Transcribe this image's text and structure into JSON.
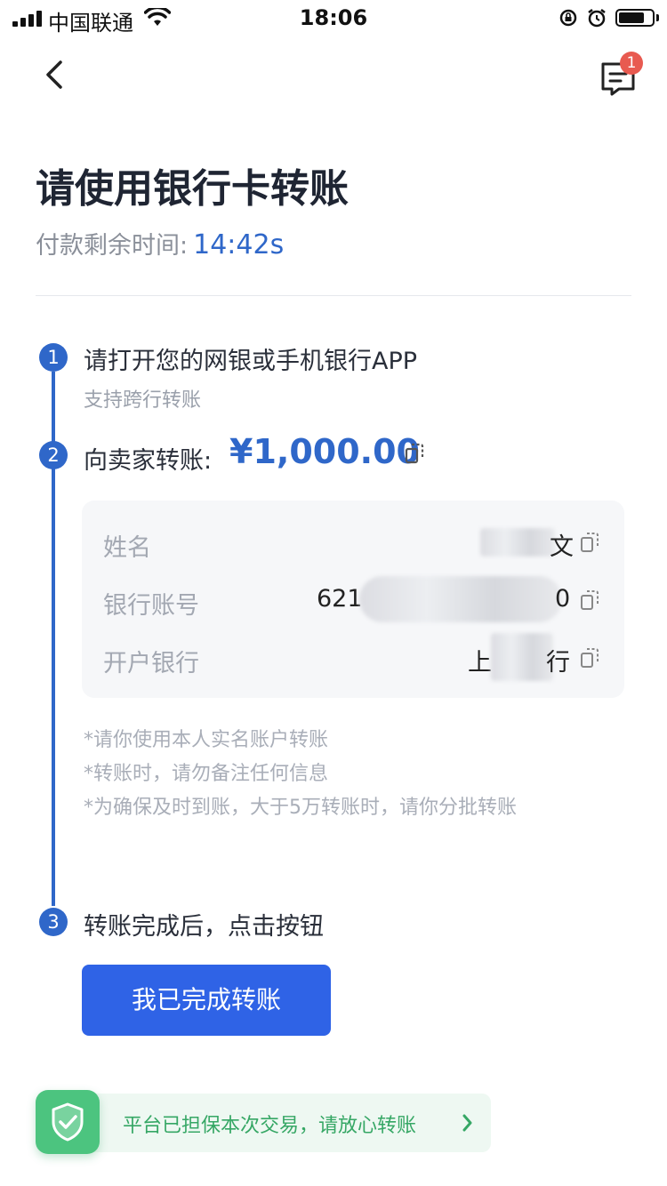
{
  "status_bar": {
    "carrier": "中国联通",
    "time": "18:06"
  },
  "nav": {
    "back_icon": "chevron-left-icon",
    "message_icon": "message-list-icon",
    "message_badge": "1"
  },
  "header": {
    "title": "请使用银行卡转账",
    "timer_label": "付款剩余时间:",
    "timer_value": "14:42s"
  },
  "steps": [
    {
      "number": "1",
      "title": "请打开您的网银或手机银行APP",
      "subtitle": "支持跨行转账"
    },
    {
      "number": "2",
      "title": "向卖家转账:",
      "amount": "¥1,000.00"
    },
    {
      "number": "3",
      "title": "转账完成后，点击按钮"
    }
  ],
  "payee": {
    "name_label": "姓名",
    "name_suffix": "文",
    "account_label": "银行账号",
    "account_prefix": "621",
    "account_suffix": "0",
    "bank_label": "开户银行",
    "bank_prefix": "上",
    "bank_suffix": "行"
  },
  "notes": [
    "*请你使用本人实名账户转账",
    "*转账时，请勿备注任何信息",
    "*为确保及时到账，大于5万转账时，请你分批转账"
  ],
  "confirm_button": "我已完成转账",
  "guarantee": {
    "text": "平台已担保本次交易，请放心转账",
    "icon": "shield-check-icon"
  },
  "colors": {
    "accent": "#2f67c9",
    "button": "#2f63e6",
    "guarantee_green": "#4cc47f",
    "badge_red": "#e85a50"
  }
}
